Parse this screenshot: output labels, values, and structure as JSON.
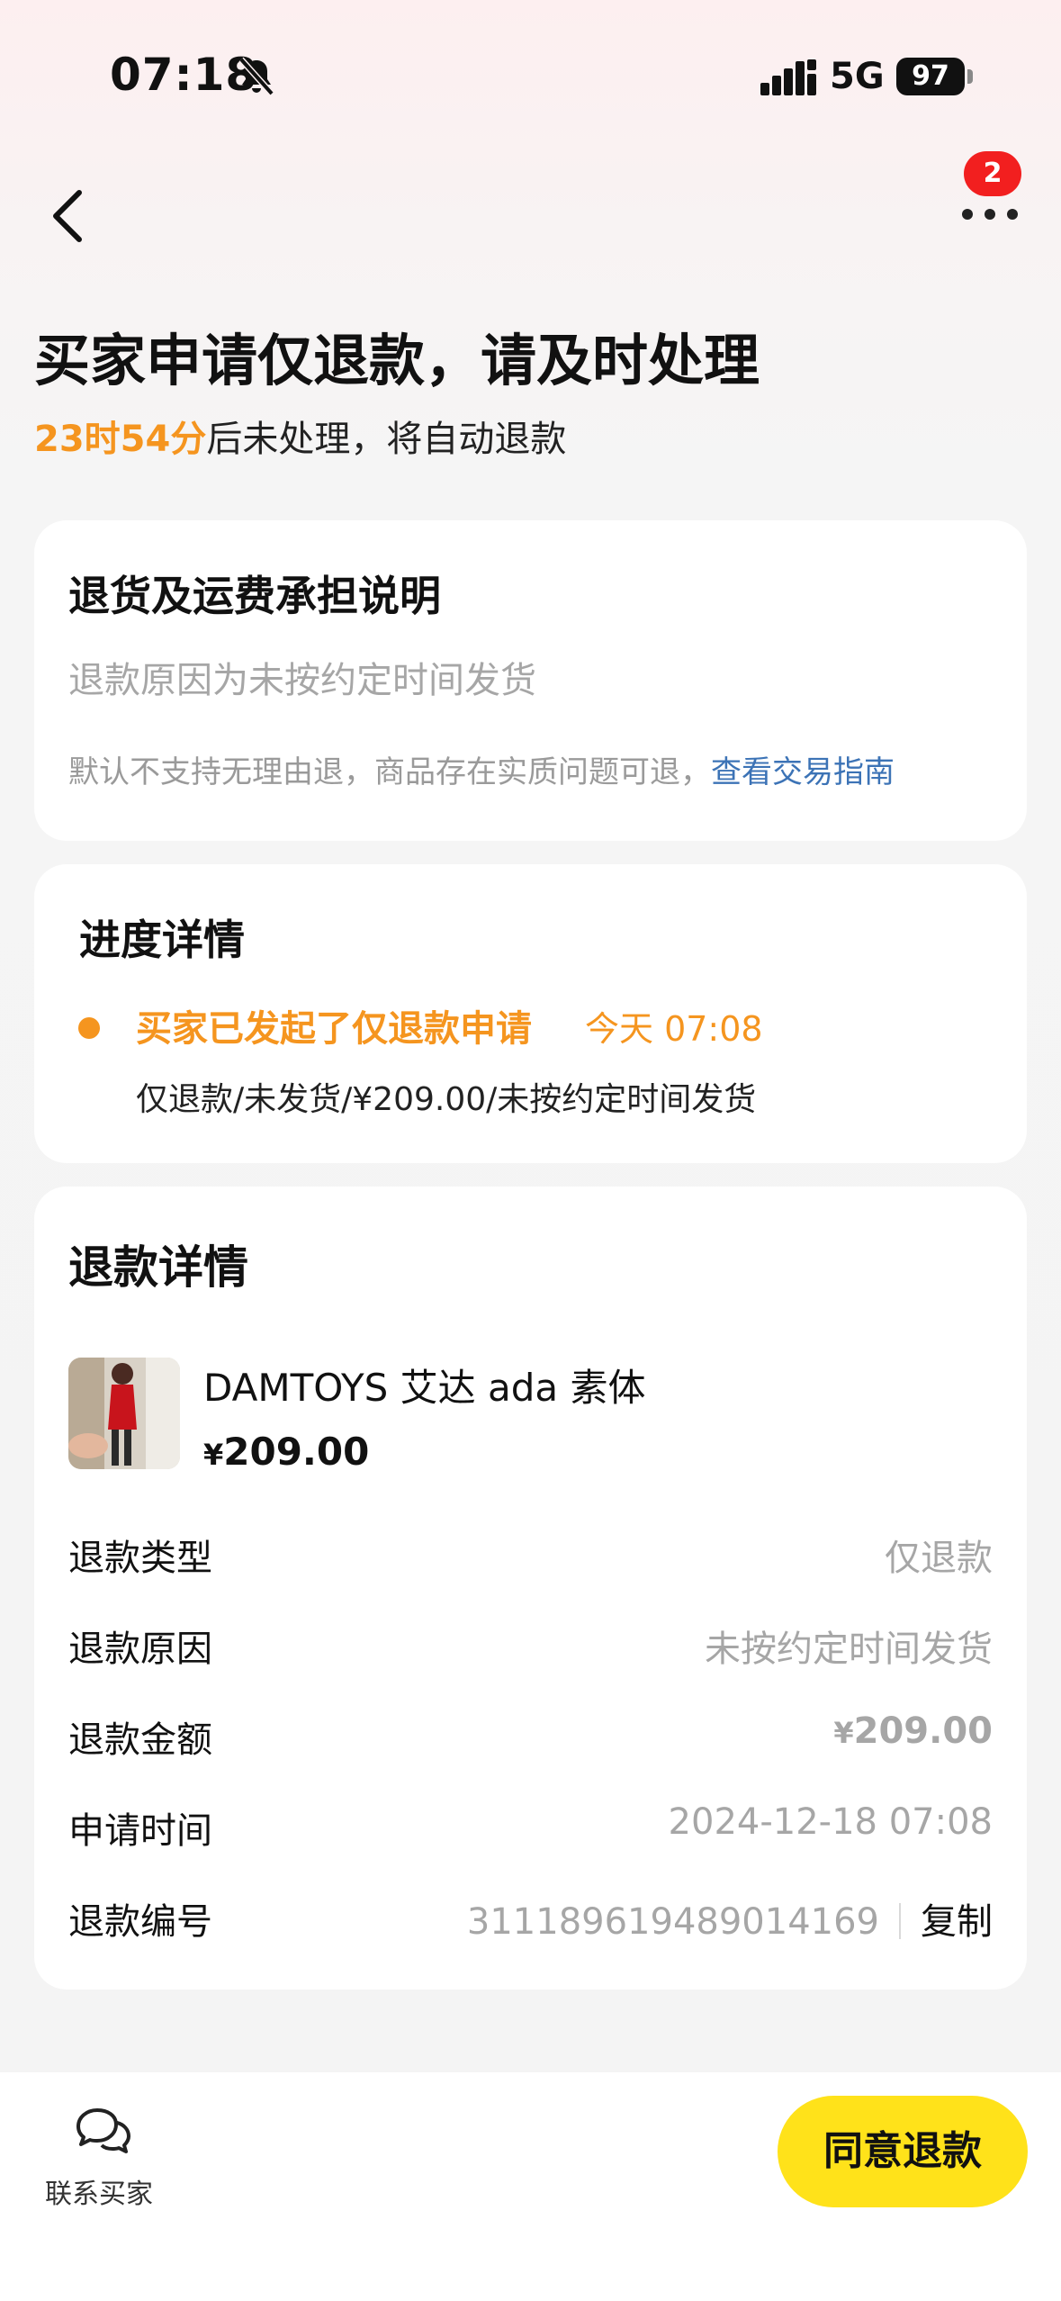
{
  "status_bar": {
    "time": "07:18",
    "network": "5G",
    "battery": "97"
  },
  "nav": {
    "badge_count": "2"
  },
  "header": {
    "title": "买家申请仅退款，请及时处理",
    "countdown": "23时54分",
    "countdown_suffix": "后未处理，将自动退款"
  },
  "policy_card": {
    "title": "退货及运费承担说明",
    "reason": "退款原因为未按约定时间发货",
    "note": "默认不支持无理由退，商品存在实质问题可退，",
    "link": "查看交易指南"
  },
  "progress_card": {
    "title": "进度详情",
    "event": "买家已发起了仅退款申请",
    "event_time": "今天 07:08",
    "event_desc": "仅退款/未发货/¥209.00/未按约定时间发货"
  },
  "refund_card": {
    "title": "退款详情",
    "product": {
      "name": "DAMTOYS 艾达 ada 素体",
      "currency": "¥",
      "price": "209.00"
    },
    "rows": [
      {
        "label": "退款类型",
        "value": "仅退款"
      },
      {
        "label": "退款原因",
        "value": "未按约定时间发货"
      },
      {
        "label": "退款金额",
        "currency": "¥",
        "value": "209.00"
      },
      {
        "label": "申请时间",
        "value": "2024-12-18 07:08"
      },
      {
        "label": "退款编号",
        "value": "311189619489014169",
        "action": "复制"
      }
    ]
  },
  "bottom_bar": {
    "contact_label": "联系买家",
    "agree_label": "同意退款"
  },
  "colors": {
    "accent_orange": "#f5951f",
    "link_blue": "#3c73b6",
    "button_yellow": "#ffe21a",
    "badge_red": "#f21f1f"
  }
}
